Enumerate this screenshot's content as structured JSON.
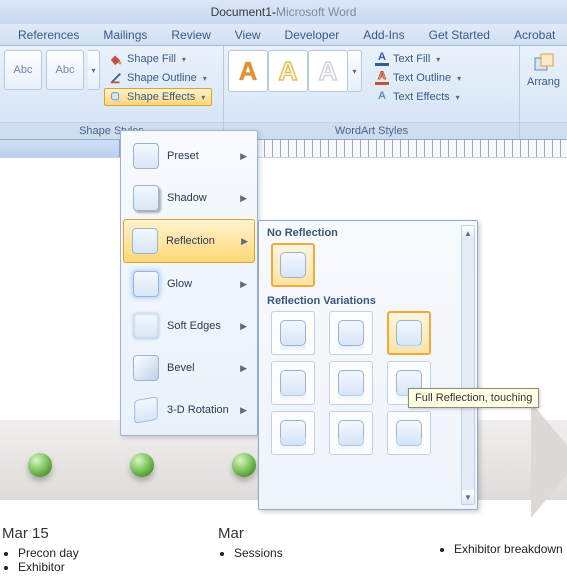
{
  "title": {
    "doc": "Document1",
    "sep": " - ",
    "app": "Microsoft Word"
  },
  "tabs": [
    "References",
    "Mailings",
    "Review",
    "View",
    "Developer",
    "Add-Ins",
    "Get Started",
    "Acrobat"
  ],
  "ribbon": {
    "shape_styles": {
      "label": "Shape Styles",
      "sample_text": "Abc",
      "fill": "Shape Fill",
      "outline": "Shape Outline",
      "effects": "Shape Effects"
    },
    "wordart_styles": {
      "label": "WordArt Styles",
      "glyph": "A",
      "text_fill": "Text Fill",
      "text_outline": "Text Outline",
      "text_effects": "Text Effects"
    },
    "arrange": {
      "label": "Arrang"
    }
  },
  "effects_menu": {
    "items": [
      {
        "label": "Preset"
      },
      {
        "label": "Shadow"
      },
      {
        "label": "Reflection",
        "selected": true
      },
      {
        "label": "Glow"
      },
      {
        "label": "Soft Edges"
      },
      {
        "label": "Bevel"
      },
      {
        "label": "3-D Rotation"
      }
    ]
  },
  "reflection_gallery": {
    "no_refl_label": "No Reflection",
    "variations_label": "Reflection Variations",
    "tooltip": "Full Reflection, touching"
  },
  "document": {
    "m_label": "M",
    "orbs": 3,
    "columns": [
      {
        "header": "Mar 15",
        "items": [
          "Precon day",
          "Exhibitor"
        ]
      },
      {
        "header": "Mar",
        "items": [
          "Sessions"
        ]
      },
      {
        "header": "",
        "items": [
          "Exhibitor breakdown"
        ]
      }
    ]
  },
  "colors": {
    "accent_text_fill": "#2f5f9a",
    "accent_text_outline": "#c1542a",
    "wordart1": "#e0923a",
    "wordart2": "#e7bb4f",
    "wordart3": "#cfd3d8"
  }
}
